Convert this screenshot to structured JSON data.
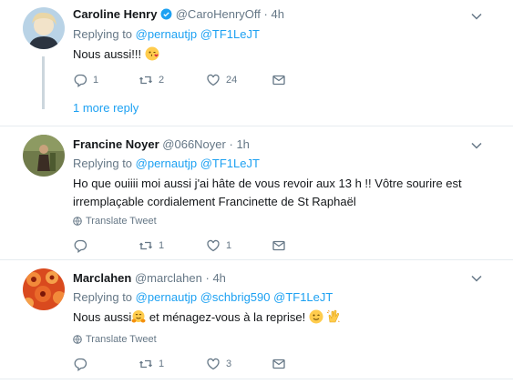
{
  "tweets": [
    {
      "name": "Caroline Henry",
      "handle": "@CaroHenryOff",
      "time": "4h",
      "replying_label": "Replying to",
      "mentions": [
        "@pernautjp",
        "@TF1LeJT"
      ],
      "text": "Nous aussi!!!",
      "counts": {
        "reply": "1",
        "retweet": "2",
        "like": "24"
      },
      "more_replies": "1 more reply"
    },
    {
      "name": "Francine Noyer",
      "handle": "@066Noyer",
      "time": "1h",
      "replying_label": "Replying to",
      "mentions": [
        "@pernautjp",
        "@TF1LeJT"
      ],
      "text_line1": "Ho que ouiiii moi aussi j'ai hâte de vous revoir  aux 13 h  !! Vôtre sourire est",
      "text_line2": "irremplaçable  cordialement Francinette de St Raphaël",
      "translate": "Translate Tweet",
      "counts": {
        "reply": "",
        "retweet": "1",
        "like": "1"
      }
    },
    {
      "name": "Marclahen",
      "handle": "@marclahen",
      "time": "4h",
      "replying_label": "Replying to",
      "mentions": [
        "@pernautjp",
        "@schbrig590",
        "@TF1LeJT"
      ],
      "text_part1": "Nous aussi",
      "text_part2": " et ménagez-vous à la reprise!",
      "translate": "Translate Tweet",
      "counts": {
        "reply": "",
        "retweet": "1",
        "like": "3"
      }
    }
  ],
  "colors": {
    "accent": "#1da1f2",
    "muted": "#657786",
    "divider": "#e6ecf0"
  },
  "icons": [
    "verified-badge-icon",
    "chevron-down-icon",
    "reply-icon",
    "retweet-icon",
    "like-icon",
    "dm-icon",
    "globe-icon",
    "face-blowing-kiss-emoji",
    "hugging-face-emoji",
    "winking-face-emoji",
    "clapping-hands-emoji"
  ]
}
